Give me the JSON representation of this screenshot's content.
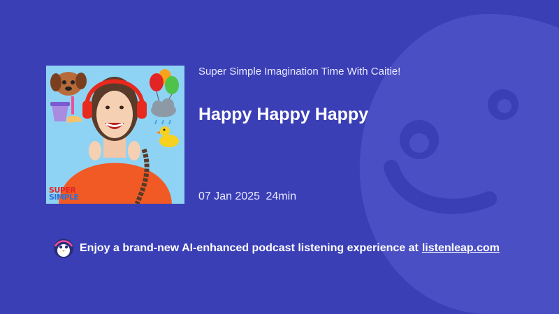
{
  "episode": {
    "show_title": "Super Simple Imagination Time With Caitie!",
    "title": "Happy Happy Happy",
    "date": "07 Jan 2025",
    "duration": "24min",
    "cover_logo_line1": "SUPER",
    "cover_logo_line2": "SIMPLE"
  },
  "promo": {
    "text": "Enjoy a brand-new AI-enhanced podcast listening experience at",
    "link_text": "listenleap.com"
  },
  "colors": {
    "background": "#3b3fb6",
    "text": "#ffffff",
    "cover_sky": "#8fd3f4"
  },
  "icons": {
    "background_logo": "listenleap-logo-watermark",
    "promo_icon": "penguin-logo-icon"
  }
}
